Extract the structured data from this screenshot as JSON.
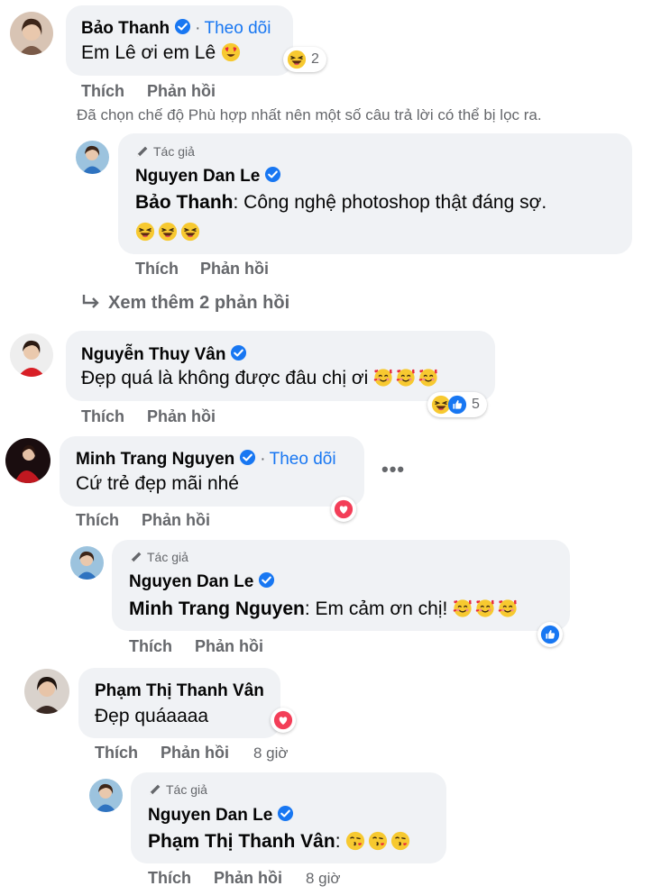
{
  "actions": {
    "like": "Thích",
    "reply": "Phản hồi"
  },
  "author_label": "Tác giả",
  "follow_label": "Theo dõi",
  "filter_notice": "Đã chọn chế độ Phù hợp nhất nên một số câu trả lời có thể bị lọc ra.",
  "view_more_replies": "Xem thêm 2 phản hồi",
  "comments": [
    {
      "name": "Bảo Thanh",
      "text": "Em Lê ơi em Lê",
      "reaction_count": "2"
    },
    {
      "name": "Nguyen Dan Le",
      "mention": "Bảo Thanh",
      "text": ": Công nghệ photoshop thật đáng sợ."
    },
    {
      "name": "Nguyễn Thuy Vân",
      "text": "Đẹp quá là không được đâu chị ơi",
      "reaction_count": "5"
    },
    {
      "name": "Minh Trang Nguyen",
      "text": "Cứ trẻ đẹp mãi nhé"
    },
    {
      "name": "Nguyen Dan Le",
      "mention": "Minh Trang Nguyen",
      "text": ": Em cảm ơn chị!"
    },
    {
      "name": "Phạm Thị Thanh Vân",
      "text": "Đẹp quáaaaa",
      "time": "8 giờ"
    },
    {
      "name": "Nguyen Dan Le",
      "mention": "Phạm Thị Thanh Vân",
      "text": ":",
      "time": "8 giờ"
    }
  ],
  "icons": {
    "verified": "verified-badge-icon",
    "laughing": "laughing-emoji-icon",
    "heart_eyes": "heart-eyes-emoji-icon",
    "smiling_hearts": "smiling-hearts-emoji-icon",
    "kiss": "kiss-emoji-icon",
    "like": "like-reaction-icon",
    "love": "love-reaction-icon",
    "pencil": "pencil-icon",
    "reply_arrow": "reply-arrow-icon"
  },
  "colors": {
    "link": "#1877f2",
    "bubble": "#f0f2f5",
    "muted": "#65676b",
    "love": "#f33e58"
  }
}
